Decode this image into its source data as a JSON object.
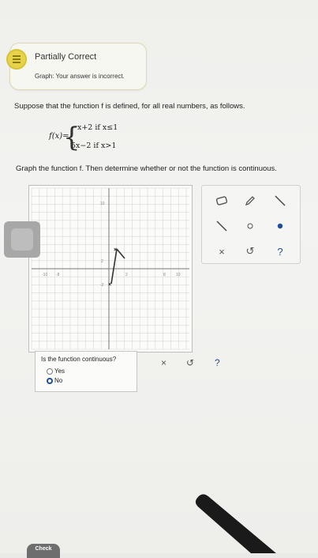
{
  "feedback": {
    "status": "Partially Correct",
    "detail": "Graph: Your answer is incorrect.",
    "icon": "partial-credit-icon"
  },
  "problem": {
    "statement": "Suppose that the function f is defined, for all real numbers, as follows.",
    "function_label": "f(x)=",
    "case1_expr": "−x+2  if x≤1",
    "case2_expr": "5x−2  if x>1",
    "instruction": "Graph the function f. Then determine whether or not the function is continuous."
  },
  "graph": {
    "x_tick_labels": [
      "-10",
      "-8",
      "2",
      "8",
      "10"
    ],
    "y_tick_labels": [
      "10",
      "2",
      "-2"
    ]
  },
  "tools": {
    "eraser_icon": "eraser-icon",
    "pencil_icon": "pencil-icon",
    "line_icon": "line-icon",
    "ray_icon": "ray-icon",
    "open_point_icon": "open-point-icon",
    "closed_point_icon": "closed-point-icon",
    "clear_label": "×",
    "undo_label": "↺",
    "help_label": "?"
  },
  "question": {
    "prompt": "Is the function continuous?",
    "options": [
      {
        "label": "Yes",
        "selected": false
      },
      {
        "label": "No",
        "selected": true
      }
    ],
    "clear_label": "×",
    "undo_label": "↺",
    "help_label": "?"
  },
  "footer": {
    "check_label": "Check"
  },
  "colors": {
    "accent": "#1e4e9a",
    "partial": "#e7d34a"
  }
}
